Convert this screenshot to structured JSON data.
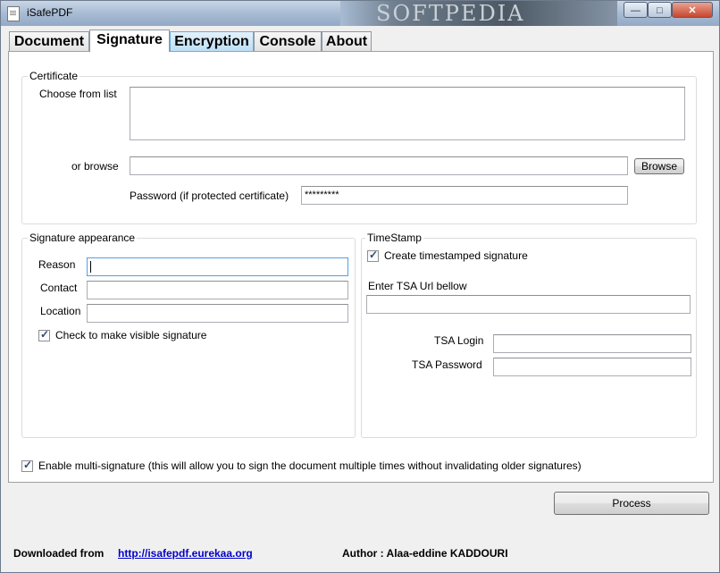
{
  "window": {
    "title": "iSafePDF",
    "banner_text": "SOFTPEDIA",
    "controls": {
      "minimize": "—",
      "maximize": "□",
      "close": "✕"
    }
  },
  "tabs": [
    {
      "label": "Document",
      "active": false
    },
    {
      "label": "Signature",
      "active": true
    },
    {
      "label": "Encryption",
      "active": false
    },
    {
      "label": "Console",
      "active": false
    },
    {
      "label": "About",
      "active": false
    }
  ],
  "certificate": {
    "group_title": "Certificate",
    "choose_label": "Choose from list",
    "browse_label": "or browse",
    "browse_value": "",
    "browse_button": "Browse",
    "password_label": "Password (if protected certificate)",
    "password_value": "*********"
  },
  "appearance": {
    "group_title": "Signature appearance",
    "reason_label": "Reason",
    "reason_value": "",
    "contact_label": "Contact",
    "contact_value": "",
    "location_label": "Location",
    "location_value": "",
    "visible_label": "Check to make visible signature",
    "visible_checked": true
  },
  "timestamp": {
    "group_title": "TimeStamp",
    "create_label": "Create timestamped signature",
    "create_checked": true,
    "url_label": "Enter TSA Url bellow",
    "url_value": "",
    "login_label": "TSA Login",
    "login_value": "",
    "password_label": "TSA Password",
    "password_value": ""
  },
  "multi_signature": {
    "label": "Enable multi-signature (this will allow you to sign the document multiple times without invalidating older signatures)",
    "checked": true
  },
  "process_button": "Process",
  "footer": {
    "downloaded_label": "Downloaded from",
    "url": "http://isafepdf.eurekaa.org",
    "author": "Author : Alaa-eddine KADDOURI"
  }
}
